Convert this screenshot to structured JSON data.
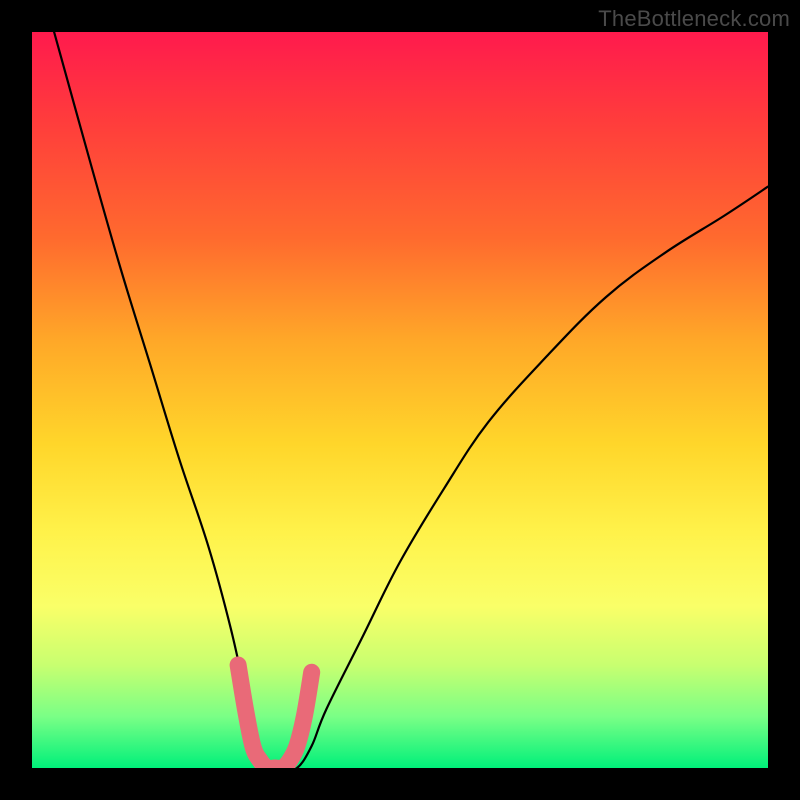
{
  "watermark": "TheBottleneck.com",
  "chart_data": {
    "type": "line",
    "title": "",
    "xlabel": "",
    "ylabel": "",
    "xlim": [
      0,
      100
    ],
    "ylim": [
      0,
      100
    ],
    "series": [
      {
        "name": "curve",
        "x": [
          3,
          8,
          12,
          16,
          20,
          24,
          27,
          29,
          30.5,
          32,
          34,
          36,
          38,
          40,
          45,
          50,
          56,
          62,
          70,
          78,
          86,
          94,
          100
        ],
        "values": [
          100,
          82,
          68,
          55,
          42,
          30,
          19,
          10,
          3,
          0,
          0,
          0,
          3,
          8,
          18,
          28,
          38,
          47,
          56,
          64,
          70,
          75,
          79
        ]
      },
      {
        "name": "highlight",
        "x": [
          28,
          29,
          30,
          31,
          32,
          33,
          34,
          35,
          36,
          37,
          38
        ],
        "values": [
          14,
          8,
          3,
          1,
          0,
          0,
          0,
          1,
          3,
          7,
          13
        ]
      }
    ],
    "background_gradient": {
      "top": "#ff1a4d",
      "mid": "#ffe84a",
      "bottom": "#00f07a"
    }
  }
}
